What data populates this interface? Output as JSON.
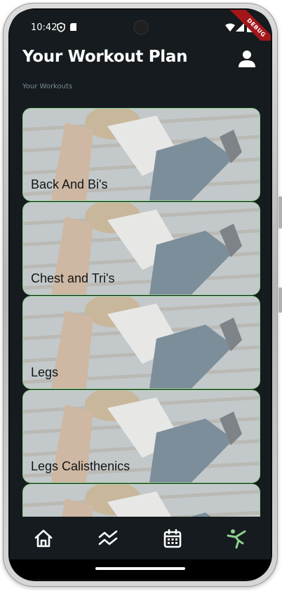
{
  "status_bar": {
    "time": "10:42",
    "debug_label": "DEBUG"
  },
  "header": {
    "title": "Your Workout Plan",
    "profile_icon": "person-icon"
  },
  "section": {
    "label": "Your Workouts"
  },
  "workouts": [
    {
      "name": "Back And Bi's"
    },
    {
      "name": "Chest and Tri's"
    },
    {
      "name": "Legs"
    },
    {
      "name": "Legs Calisthenics"
    },
    {
      "name": ""
    }
  ],
  "nav": {
    "items": [
      {
        "icon": "home-icon",
        "active": false
      },
      {
        "icon": "trend-icon",
        "active": false
      },
      {
        "icon": "calendar-icon",
        "active": false
      },
      {
        "icon": "exercise-icon",
        "active": true
      }
    ]
  },
  "colors": {
    "background": "#151b1e",
    "card_border": "#8fd08f",
    "active_nav": "#8fd08f",
    "text_primary": "#ffffff",
    "section_label": "#7b8c96"
  }
}
